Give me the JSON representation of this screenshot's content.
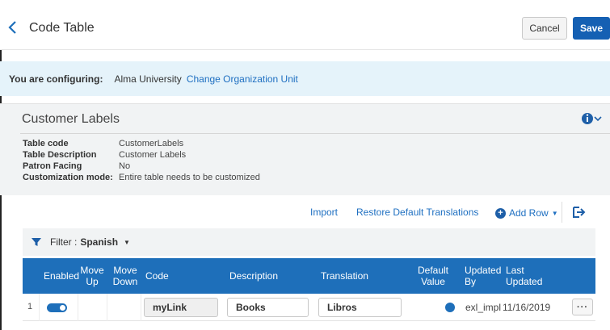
{
  "header": {
    "title": "Code Table",
    "cancel_label": "Cancel",
    "save_label": "Save"
  },
  "config_bar": {
    "label": "You are configuring:",
    "organization": "Alma University",
    "change_link": "Change Organization Unit"
  },
  "panel": {
    "title": "Customer Labels",
    "info_icon": "info-icon",
    "fields": [
      {
        "key": "Table code",
        "value": "CustomerLabels"
      },
      {
        "key": "Table Description",
        "value": "Customer Labels"
      },
      {
        "key": "Patron Facing",
        "value": "No"
      },
      {
        "key": "Customization mode:",
        "value": "Entire table needs to be customized"
      }
    ]
  },
  "toolbar": {
    "import": "Import",
    "restore": "Restore Default Translations",
    "add_row": "Add Row",
    "add_icon": "plus-circle-icon",
    "export_icon": "export-icon"
  },
  "filter": {
    "label": "Filter :",
    "value": "Spanish",
    "icon": "filter-icon"
  },
  "table": {
    "columns": [
      "Enabled",
      "Move Up",
      "Move Down",
      "Code",
      "Description",
      "Translation",
      "Default Value",
      "Updated By",
      "Last Updated"
    ],
    "rows": [
      {
        "index": "1",
        "enabled": true,
        "code": "myLink",
        "description": "Books",
        "translation": "Libros",
        "default": true,
        "updated_by": "exl_impl",
        "last_updated": "11/16/2019",
        "more": "···"
      }
    ]
  },
  "colors": {
    "accent": "#1e6fba",
    "save": "#1560b3",
    "config_bg": "#e5f3fa",
    "panel_bg": "#f1f3f4",
    "link": "#1e6fc1"
  }
}
